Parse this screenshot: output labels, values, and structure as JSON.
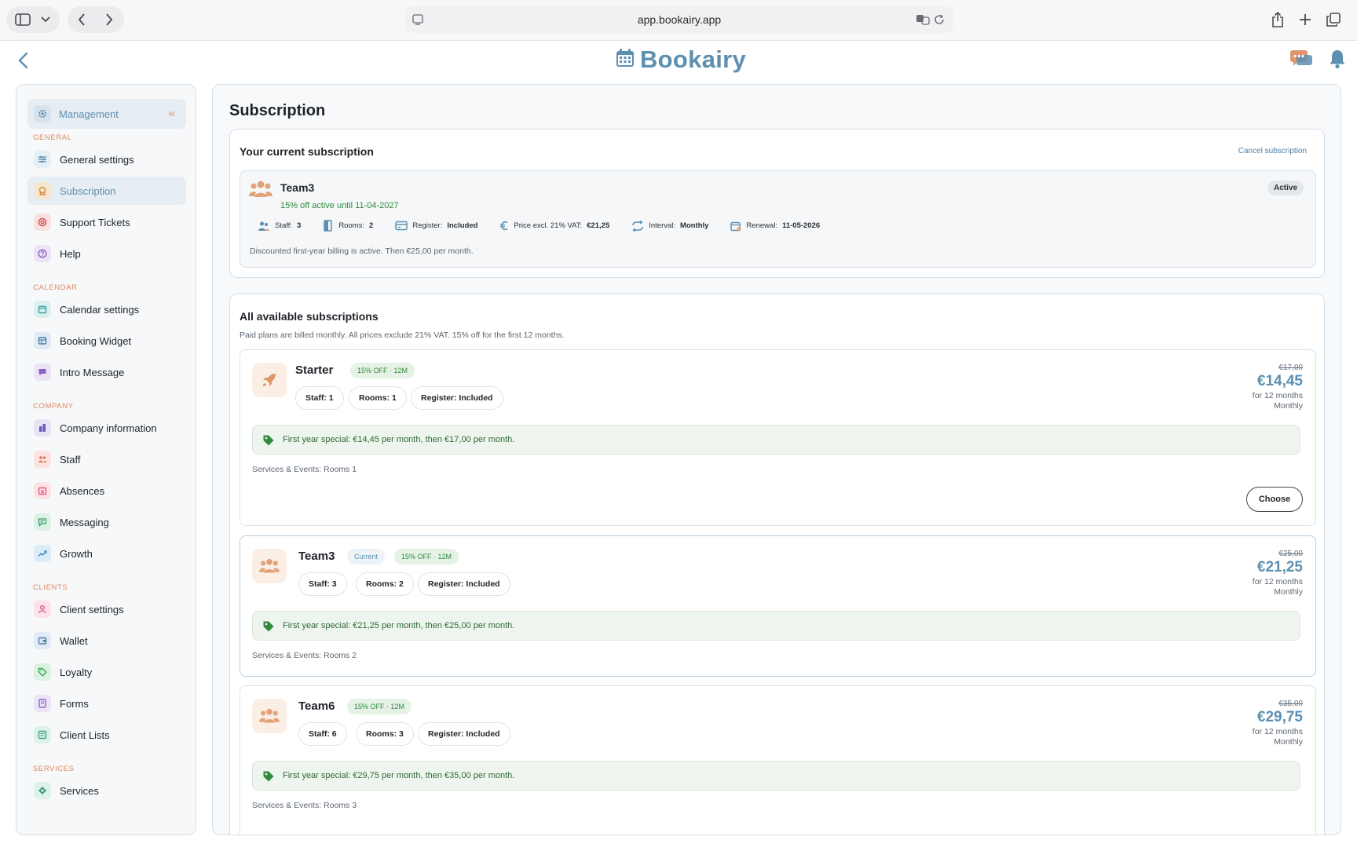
{
  "browser": {
    "url": "app.bookairy.app"
  },
  "header": {
    "logo_text": "Bookairy"
  },
  "sidebar": {
    "title": "Management",
    "sections": [
      {
        "label": "GENERAL",
        "items": [
          {
            "label": "General settings",
            "icon": "sliders-icon",
            "color": "#e6eef6",
            "fg": "#5d8fb1"
          },
          {
            "label": "Subscription",
            "icon": "badge-icon",
            "color": "#f6e7d2",
            "fg": "#d48a3a",
            "active": true
          },
          {
            "label": "Support Tickets",
            "icon": "lifebuoy-icon",
            "color": "#f9e1e1",
            "fg": "#d9534f"
          },
          {
            "label": "Help",
            "icon": "question-icon",
            "color": "#ece4f6",
            "fg": "#8a64c4"
          }
        ]
      },
      {
        "label": "CALENDAR",
        "items": [
          {
            "label": "Calendar settings",
            "icon": "calendar-icon",
            "color": "#dcf0f0",
            "fg": "#3ba0a0"
          },
          {
            "label": "Booking Widget",
            "icon": "widget-icon",
            "color": "#e1eaf6",
            "fg": "#4b7ea5"
          },
          {
            "label": "Intro Message",
            "icon": "message-icon",
            "color": "#ece4f6",
            "fg": "#8a64c4"
          }
        ]
      },
      {
        "label": "COMPANY",
        "items": [
          {
            "label": "Company information",
            "icon": "building-icon",
            "color": "#e8e4f8",
            "fg": "#6a5ac4"
          },
          {
            "label": "Staff",
            "icon": "users-icon",
            "color": "#fbe4e0",
            "fg": "#e0715a"
          },
          {
            "label": "Absences",
            "icon": "calendar-x-icon",
            "color": "#fde2e6",
            "fg": "#e05a78"
          },
          {
            "label": "Messaging",
            "icon": "chat-icon",
            "color": "#dcf2e6",
            "fg": "#3ba06a"
          },
          {
            "label": "Growth",
            "icon": "trend-icon",
            "color": "#dcecf6",
            "fg": "#4b8fc4"
          }
        ]
      },
      {
        "label": "CLIENTS",
        "items": [
          {
            "label": "Client settings",
            "icon": "user-icon",
            "color": "#fde2ea",
            "fg": "#e05a84"
          },
          {
            "label": "Wallet",
            "icon": "wallet-icon",
            "color": "#e1eaf6",
            "fg": "#4b7ea5"
          },
          {
            "label": "Loyalty",
            "icon": "tag-icon",
            "color": "#dcf2e0",
            "fg": "#3ba05a"
          },
          {
            "label": "Forms",
            "icon": "form-icon",
            "color": "#ece4f6",
            "fg": "#8a64c4"
          },
          {
            "label": "Client Lists",
            "icon": "list-icon",
            "color": "#dcf2ea",
            "fg": "#3ba07a"
          }
        ]
      },
      {
        "label": "SERVICES",
        "items": [
          {
            "label": "Services",
            "icon": "diamond-icon",
            "color": "#dcf2ea",
            "fg": "#3ba07a"
          }
        ]
      }
    ]
  },
  "main": {
    "title": "Subscription",
    "current": {
      "heading": "Your current subscription",
      "cancel_label": "Cancel subscription",
      "plan_name": "Team3",
      "discount_text": "15% off active until 11-04-2027",
      "status": "Active",
      "meta": [
        {
          "label": "Staff:",
          "value": "3",
          "icon": "users-icon"
        },
        {
          "label": "Rooms:",
          "value": "2",
          "icon": "door-icon"
        },
        {
          "label": "Register:",
          "value": "Included",
          "icon": "register-icon"
        },
        {
          "label": "Price excl. 21% VAT:",
          "value": "€21,25",
          "icon": "euro-icon"
        },
        {
          "label": "Interval:",
          "value": "Monthly",
          "icon": "repeat-icon"
        },
        {
          "label": "Renewal:",
          "value": "11-05-2026",
          "icon": "calendar-icon"
        }
      ],
      "note": "Discounted first-year billing is active. Then €25,00 per month."
    },
    "available": {
      "heading": "All available subscriptions",
      "subtitle": "Paid plans are billed monthly. All prices exclude 21% VAT. 15% off for the first 12 months.",
      "plans": [
        {
          "name": "Starter",
          "icon": "rocket-icon",
          "current_label": "",
          "discount_badge": "15% OFF · 12M",
          "chips": [
            "Staff: 1",
            "Rooms: 1",
            "Register: Included"
          ],
          "special": "First year special: €14,45 per month, then €17,00 per month.",
          "services": "Services & Events: Rooms 1",
          "price_old": "€17,00",
          "price_new": "€14,45",
          "price_period": "for 12 months",
          "price_interval": "Monthly",
          "choose_label": "Choose"
        },
        {
          "name": "Team3",
          "icon": "users-icon",
          "current_label": "Current",
          "discount_badge": "15% OFF · 12M",
          "chips": [
            "Staff: 3",
            "Rooms: 2",
            "Register: Included"
          ],
          "special": "First year special: €21,25 per month, then €25,00 per month.",
          "services": "Services & Events: Rooms 2",
          "price_old": "€25,00",
          "price_new": "€21,25",
          "price_period": "for 12 months",
          "price_interval": "Monthly"
        },
        {
          "name": "Team6",
          "icon": "users-icon",
          "current_label": "",
          "discount_badge": "15% OFF · 12M",
          "chips": [
            "Staff: 6",
            "Rooms: 3",
            "Register: Included"
          ],
          "special": "First year special: €29,75 per month, then €35,00 per month.",
          "services": "Services & Events: Rooms 3",
          "price_old": "€35,00",
          "price_new": "€29,75",
          "price_period": "for 12 months",
          "price_interval": "Monthly"
        }
      ]
    }
  }
}
